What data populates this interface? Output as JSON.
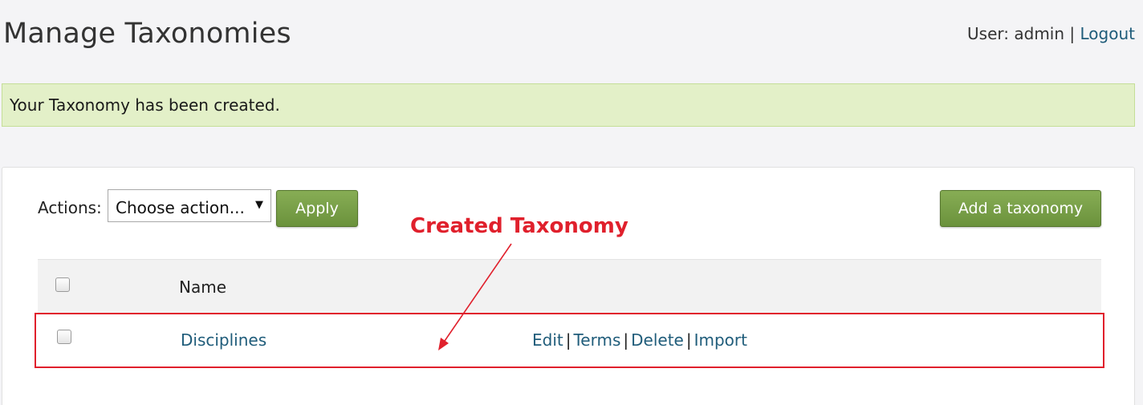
{
  "header": {
    "title": "Manage Taxonomies",
    "user_prefix": "User: admin",
    "separator": "|",
    "logout_label": "Logout"
  },
  "flash": {
    "message": "Your Taxonomy has been created."
  },
  "toolbar": {
    "actions_label": "Actions:",
    "select_value": "Choose action...",
    "caret": "▼",
    "apply_label": "Apply",
    "add_label": "Add a taxonomy"
  },
  "table": {
    "header_name": "Name",
    "rows": [
      {
        "name": "Disciplines",
        "actions": [
          "Edit",
          "Terms",
          "Delete",
          "Import"
        ]
      }
    ],
    "separator": "|"
  },
  "annotation": {
    "text": "Created Taxonomy",
    "color": "#e0202c"
  },
  "colors": {
    "link": "#1f5c7a",
    "button_green": "#7aa04a",
    "flash_bg": "#e3f0c8"
  }
}
